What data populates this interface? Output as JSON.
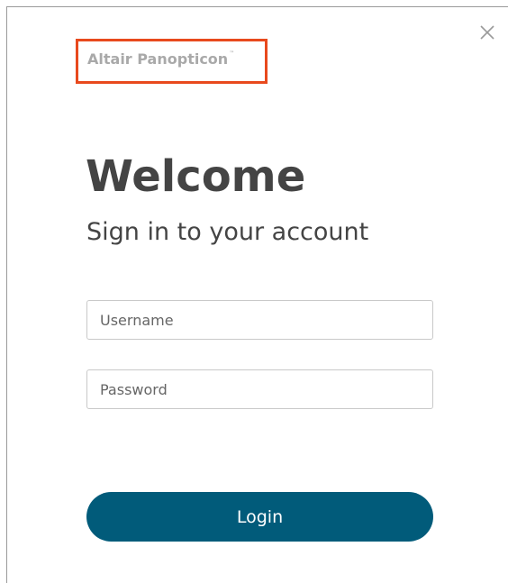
{
  "brand": {
    "name": "Altair Panopticon",
    "trademark": "™",
    "highlight_color": "#e8491d"
  },
  "dialog": {
    "close_icon": "close-icon",
    "title": "Welcome",
    "subtitle": "Sign in to your account"
  },
  "form": {
    "username_placeholder": "Username",
    "username_value": "",
    "password_placeholder": "Password",
    "password_value": "",
    "login_label": "Login"
  },
  "colors": {
    "button": "#015b7a",
    "text": "#444444"
  }
}
